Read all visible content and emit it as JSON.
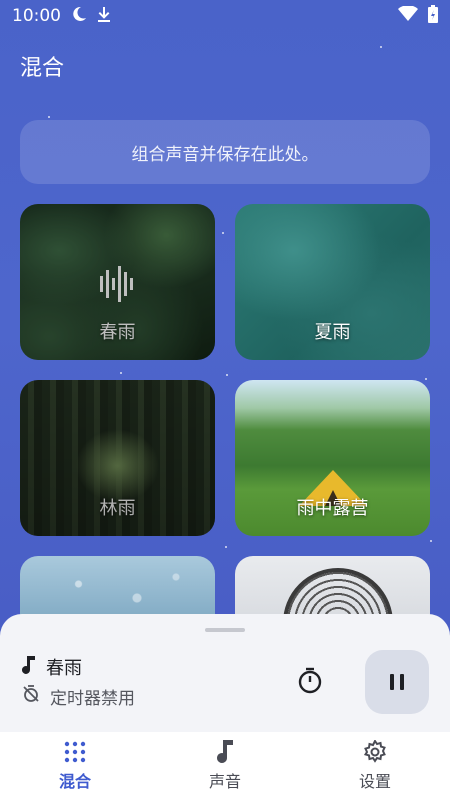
{
  "status_bar": {
    "time": "10:00",
    "icons": [
      "moon-icon",
      "download-icon",
      "wifi-icon",
      "battery-icon"
    ]
  },
  "app_bar": {
    "title": "混合"
  },
  "hint": {
    "text": "组合声音并保存在此处。"
  },
  "sounds": [
    {
      "label": "春雨",
      "playing": true
    },
    {
      "label": "夏雨",
      "playing": false
    },
    {
      "label": "林雨",
      "playing": false
    },
    {
      "label": "雨中露营",
      "playing": false
    },
    {
      "label": "",
      "playing": false
    },
    {
      "label": "",
      "playing": false
    }
  ],
  "player": {
    "now_playing": "春雨",
    "timer_status": "定时器禁用"
  },
  "bottom_nav": {
    "items": [
      {
        "label": "混合",
        "icon": "grid-dots-icon",
        "active": true
      },
      {
        "label": "声音",
        "icon": "music-note-icon",
        "active": false
      },
      {
        "label": "设置",
        "icon": "gear-icon",
        "active": false
      }
    ]
  },
  "colors": {
    "background": "#4a63c9",
    "accent": "#3f5bcf",
    "sheet": "#f3f4f8"
  }
}
